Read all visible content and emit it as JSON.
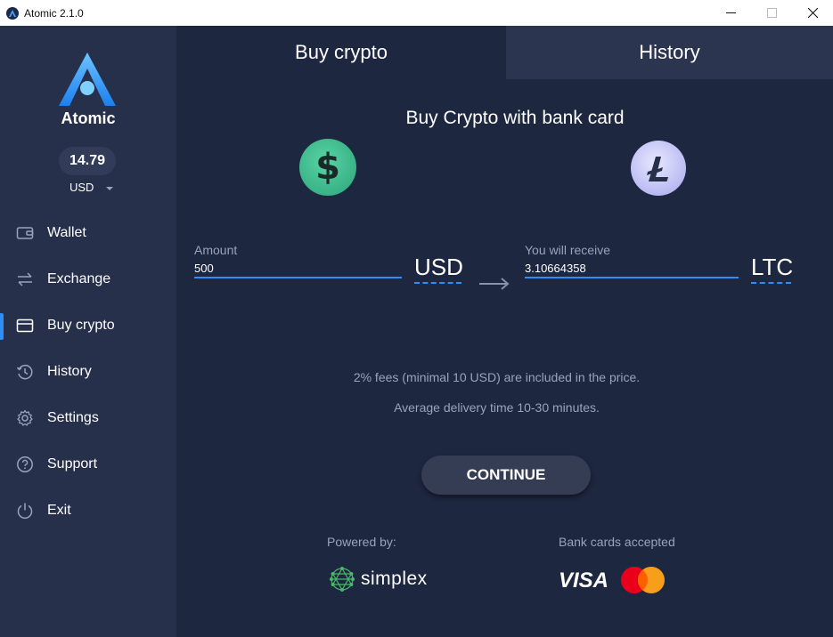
{
  "window": {
    "title": "Atomic 2.1.0"
  },
  "sidebar": {
    "brand": "Atomic",
    "balance": "14.79",
    "currency": "USD",
    "items": [
      {
        "label": "Wallet",
        "icon": "wallet-icon"
      },
      {
        "label": "Exchange",
        "icon": "exchange-icon"
      },
      {
        "label": "Buy crypto",
        "icon": "card-icon",
        "active": true
      },
      {
        "label": "History",
        "icon": "history-icon"
      },
      {
        "label": "Settings",
        "icon": "gear-icon"
      },
      {
        "label": "Support",
        "icon": "help-icon"
      },
      {
        "label": "Exit",
        "icon": "power-icon"
      }
    ]
  },
  "tabs": [
    {
      "label": "Buy crypto",
      "active": true
    },
    {
      "label": "History",
      "active": false
    }
  ],
  "main": {
    "heading": "Buy Crypto with bank card",
    "amount_label": "Amount",
    "amount_value": "500",
    "amount_unit": "USD",
    "receive_label": "You will receive",
    "receive_value": "3.10664358",
    "receive_unit": "LTC",
    "fee_note": "2% fees (minimal 10 USD) are included in the price.",
    "delivery_note": "Average delivery time 10-30 minutes.",
    "continue_label": "CONTINUE",
    "powered_by_label": "Powered by:",
    "provider_name": "simplex",
    "bank_cards_label": "Bank cards accepted",
    "card_visa": "VISA"
  },
  "colors": {
    "accent": "#2f8ef5",
    "sidebar_bg": "#27304b",
    "main_bg": "#1e2740",
    "usd_coin": "#3cbf8e",
    "ltc_coin": "#c4c5f5",
    "mastercard_red": "#eb001b",
    "mastercard_orange": "#f79e1b"
  }
}
